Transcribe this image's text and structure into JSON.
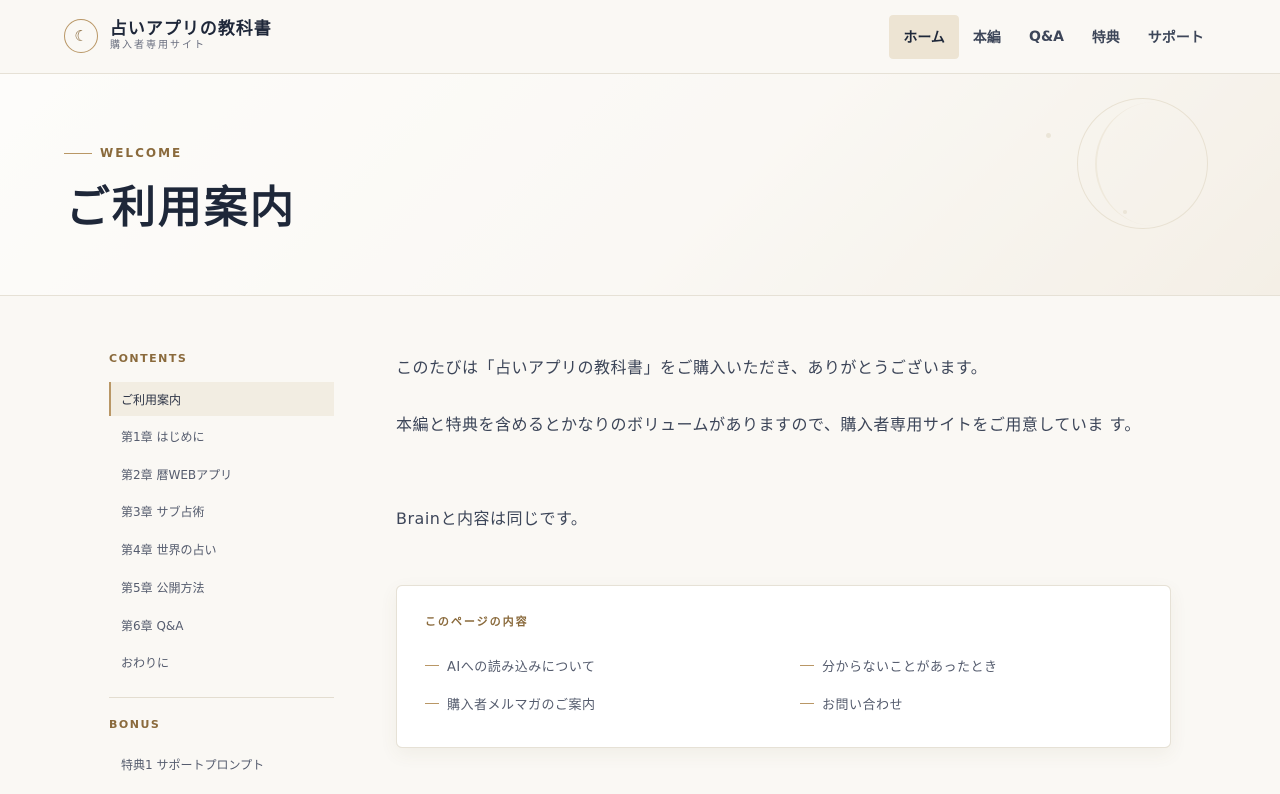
{
  "header": {
    "logo_symbol": "☾",
    "site_title": "占いアプリの教科書",
    "site_subtitle": "購入者専用サイト",
    "nav": [
      {
        "label": "ホーム",
        "active": true
      },
      {
        "label": "本編",
        "active": false
      },
      {
        "label": "Q&A",
        "active": false
      },
      {
        "label": "特典",
        "active": false
      },
      {
        "label": "サポート",
        "active": false
      }
    ]
  },
  "hero": {
    "eyebrow": "WELCOME",
    "title": "ご利用案内"
  },
  "sidebar": {
    "contents_heading": "CONTENTS",
    "items": [
      {
        "label": "ご利用案内",
        "active": true
      },
      {
        "label": "第1章 はじめに",
        "active": false
      },
      {
        "label": "第2章 暦WEBアプリ",
        "active": false
      },
      {
        "label": "第3章 サブ占術",
        "active": false
      },
      {
        "label": "第4章 世界の占い",
        "active": false
      },
      {
        "label": "第5章 公開方法",
        "active": false
      },
      {
        "label": "第6章 Q&A",
        "active": false
      },
      {
        "label": "おわりに",
        "active": false
      }
    ],
    "bonus_heading": "BONUS",
    "bonus_items": [
      {
        "label": "特典1 サポートプロンプト"
      }
    ]
  },
  "main": {
    "paragraphs": [
      "このたびは「占いアプリの教科書」をご購入いただき、ありがとうございます。",
      "本編と特典を含めるとかなりのボリュームがありますので、購入者専用サイトをご用意していま す。",
      "Brainと内容は同じです。"
    ],
    "toc": {
      "title": "このページの内容",
      "links": [
        "AIへの読み込みについて",
        "分からないことがあったとき",
        "購入者メルマガのご案内",
        "お問い合わせ"
      ]
    }
  },
  "colors": {
    "accent": "#b99766",
    "accent_text": "#8a6a3c",
    "navy": "#1e2739",
    "background": "#faf8f4",
    "active_bg": "#ede4d3"
  }
}
